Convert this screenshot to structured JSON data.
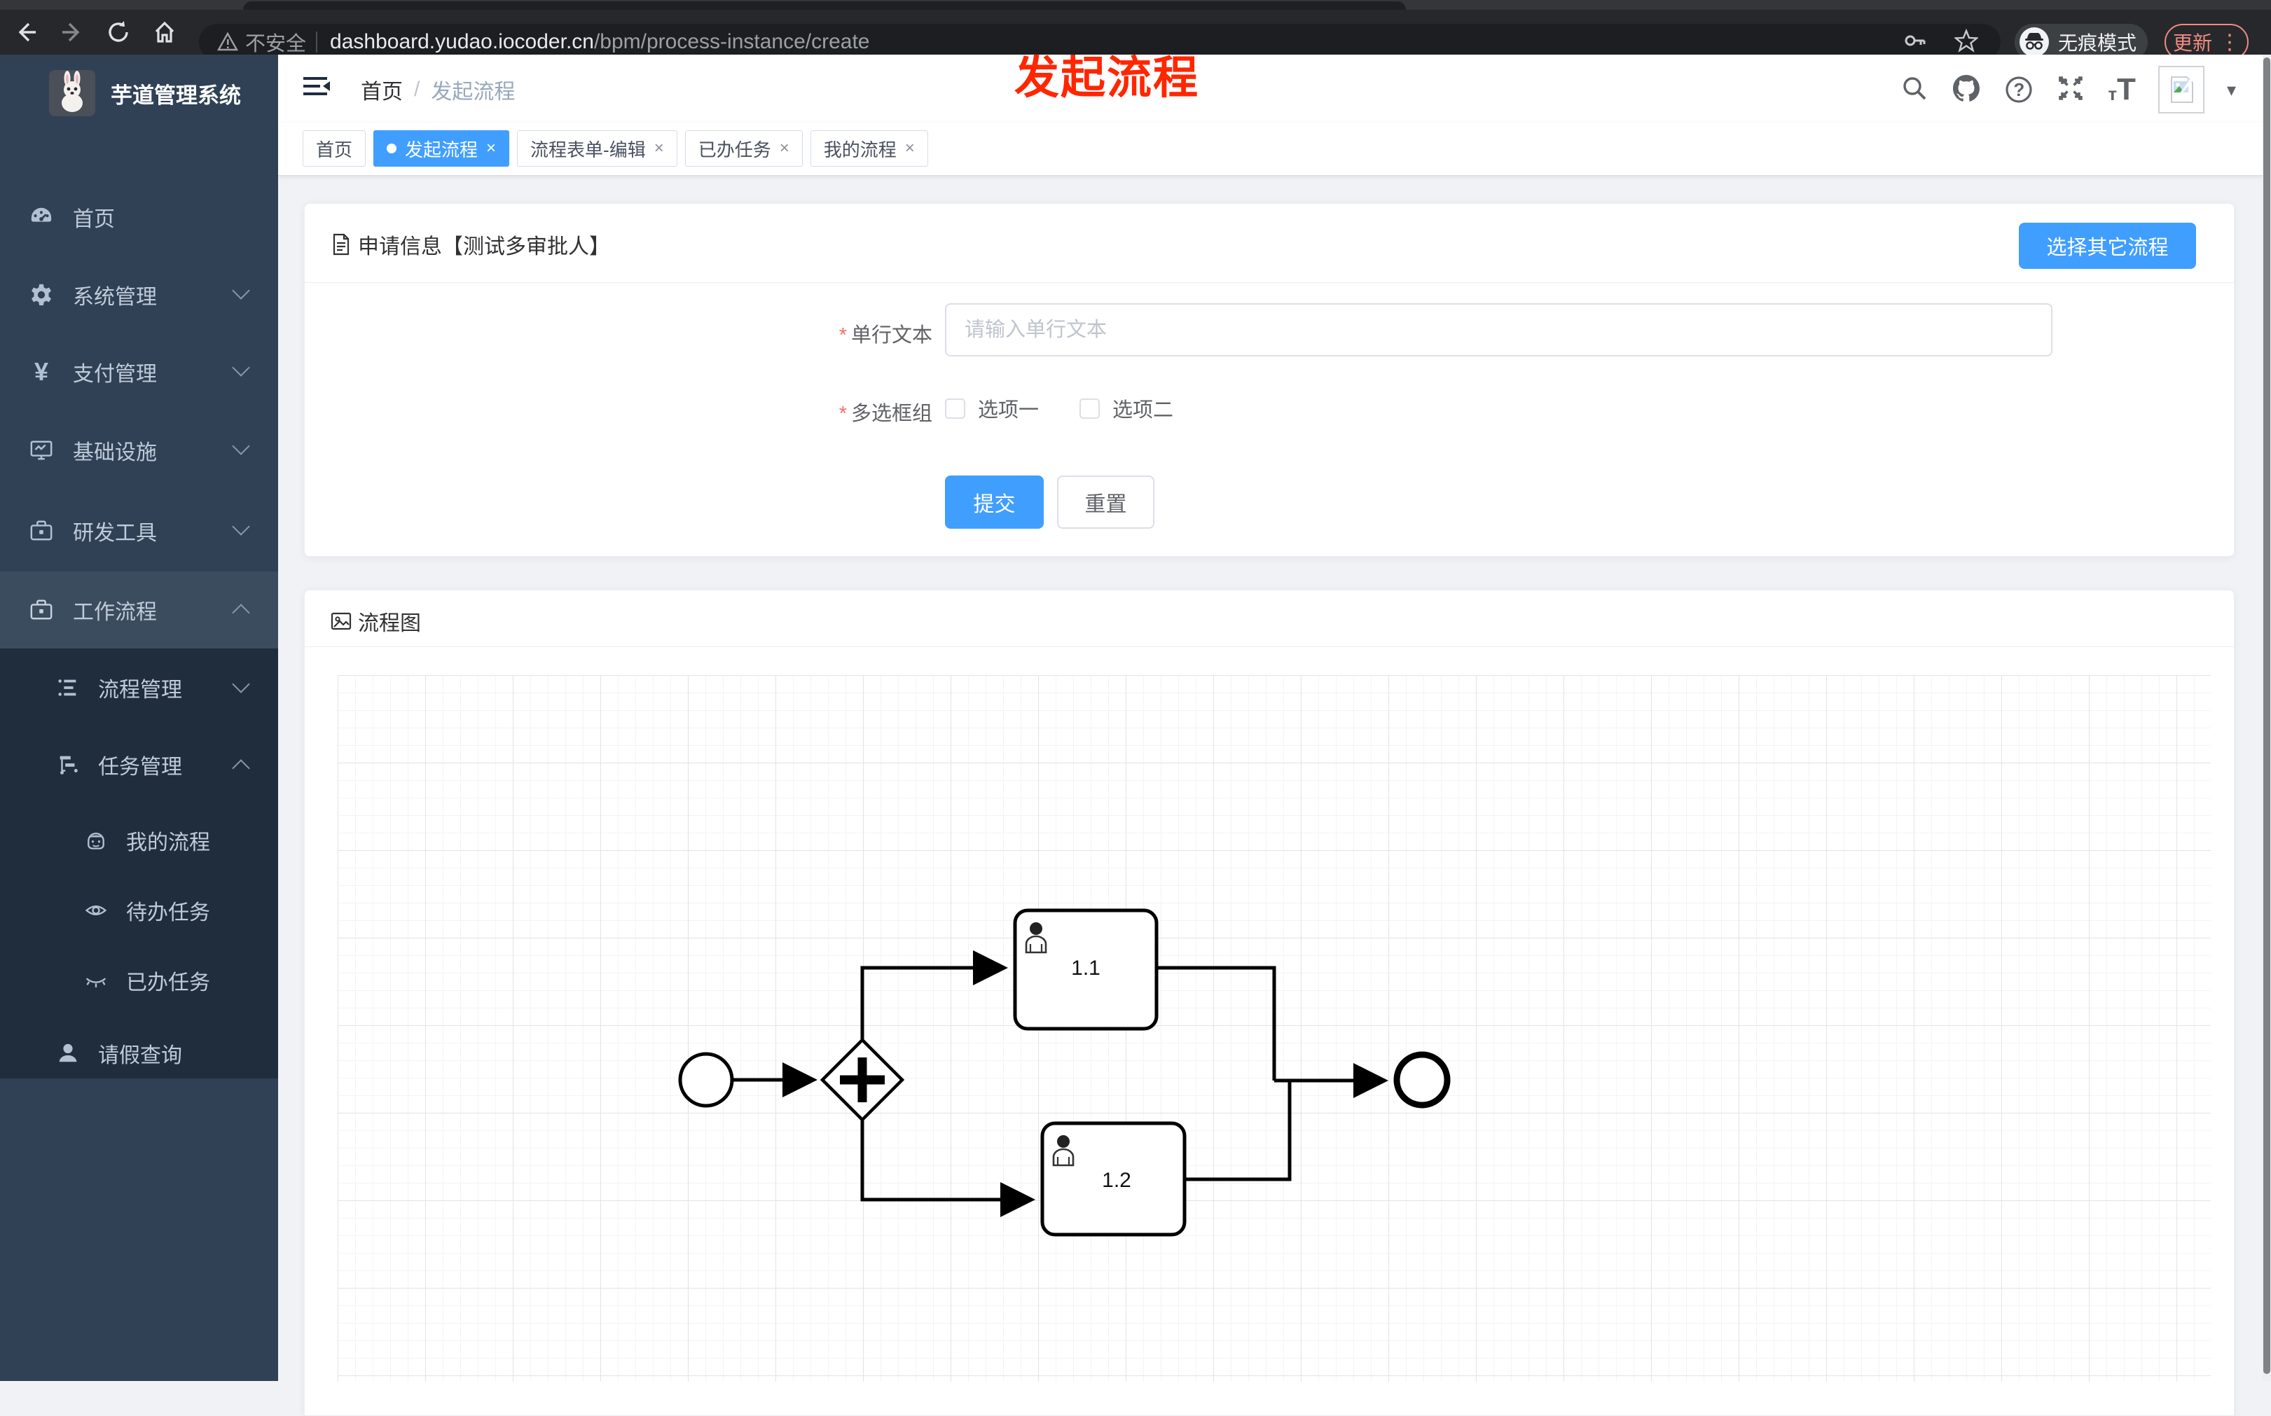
{
  "browser": {
    "security_label": "不安全",
    "url_host": "dashboard.yudao.iocoder.cn",
    "url_path": "/bpm/process-instance/create",
    "incognito_label": "无痕模式",
    "update_label": "更新"
  },
  "annotation": {
    "title": "发起流程"
  },
  "sidebar": {
    "title": "芋道管理系统",
    "items": [
      {
        "label": "首页"
      },
      {
        "label": "系统管理"
      },
      {
        "label": "支付管理"
      },
      {
        "label": "基础设施"
      },
      {
        "label": "研发工具"
      },
      {
        "label": "工作流程"
      }
    ],
    "submenu": [
      {
        "label": "流程管理"
      },
      {
        "label": "任务管理"
      },
      {
        "label": "我的流程"
      },
      {
        "label": "待办任务"
      },
      {
        "label": "已办任务"
      },
      {
        "label": "请假查询"
      }
    ]
  },
  "header": {
    "breadcrumb": {
      "home": "首页",
      "current": "发起流程"
    },
    "tabs": [
      {
        "label": "首页"
      },
      {
        "label": "发起流程"
      },
      {
        "label": "流程表单-编辑"
      },
      {
        "label": "已办任务"
      },
      {
        "label": "我的流程"
      }
    ]
  },
  "form_card": {
    "title": "申请信息【测试多审批人】",
    "other_process_button": "选择其它流程",
    "fields": [
      {
        "label": "单行文本",
        "placeholder": "请输入单行文本"
      },
      {
        "label": "多选框组",
        "options": [
          "选项一",
          "选项二"
        ]
      }
    ],
    "submit_label": "提交",
    "reset_label": "重置"
  },
  "diagram_card": {
    "title": "流程图",
    "tasks": [
      {
        "label": "1.1"
      },
      {
        "label": "1.2"
      }
    ]
  },
  "glyphs": {
    "close": "×",
    "slash": "/",
    "caret": "▾",
    "dots": "⋮",
    "question": "?",
    "t_small": "т",
    "t_large": "T"
  }
}
